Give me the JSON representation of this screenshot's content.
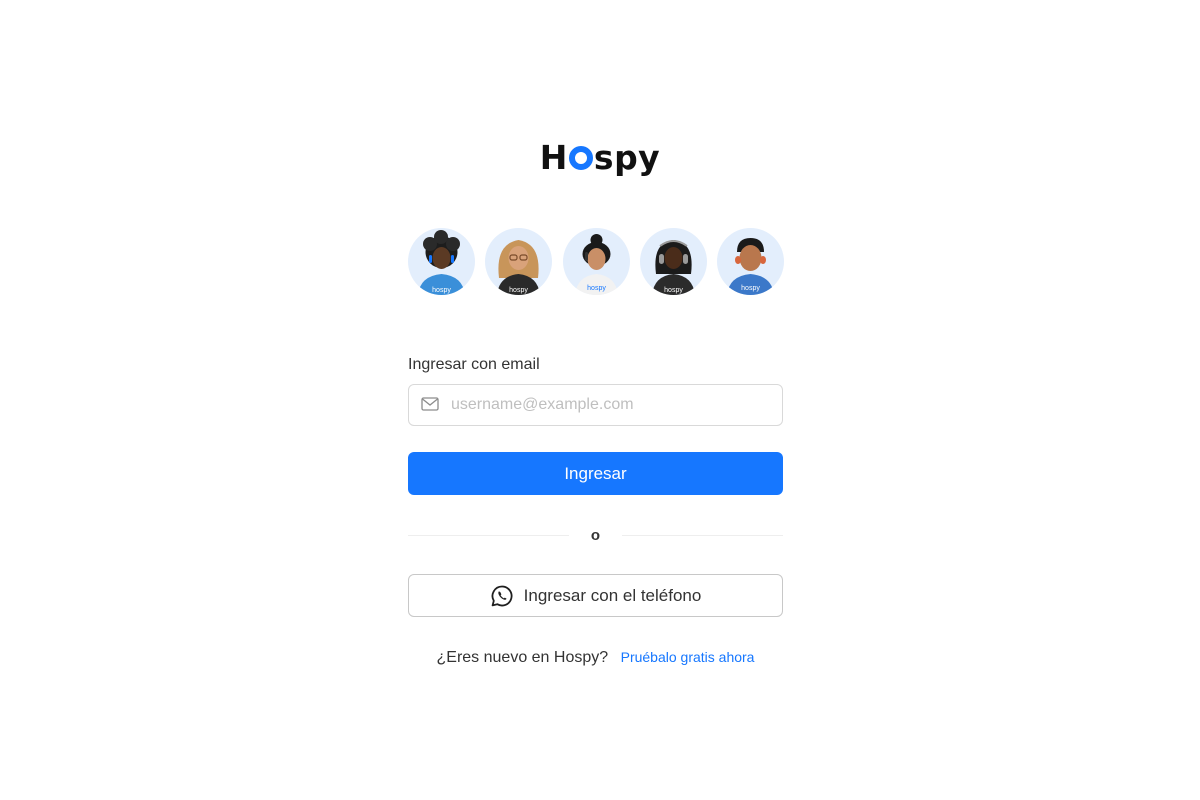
{
  "brand": {
    "logo_prefix": "H",
    "logo_suffix": "spy",
    "accent_color": "#1677ff"
  },
  "avatars": [
    {
      "name": "avatar-1",
      "shirt_text": "hospy"
    },
    {
      "name": "avatar-2",
      "shirt_text": "hospy"
    },
    {
      "name": "avatar-3",
      "shirt_text": "hospy"
    },
    {
      "name": "avatar-4",
      "shirt_text": "hospy"
    },
    {
      "name": "avatar-5",
      "shirt_text": "hospy"
    }
  ],
  "login": {
    "email_label": "Ingresar con email",
    "email_value": "",
    "email_placeholder": "username@example.com",
    "email_icon": "mail-icon",
    "submit_label": "Ingresar",
    "divider_text": "o",
    "phone_label": "Ingresar con el teléfono",
    "phone_icon": "whatsapp-icon"
  },
  "signup": {
    "prompt": "¿Eres nuevo en Hospy?",
    "link_label": "Pruébalo gratis ahora"
  }
}
